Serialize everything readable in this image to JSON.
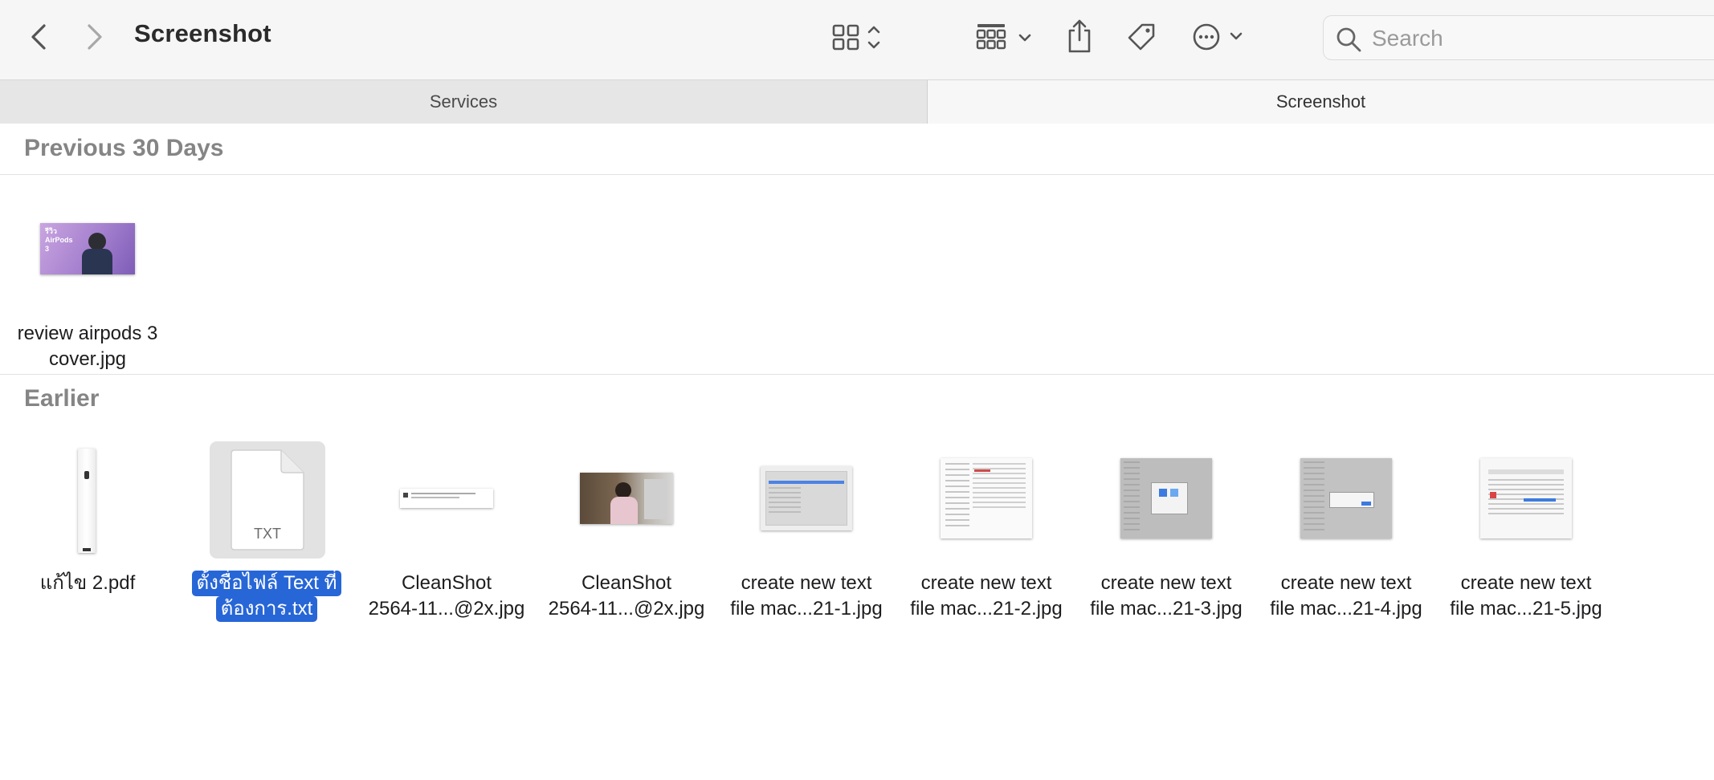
{
  "window": {
    "title": "Screenshot"
  },
  "search": {
    "placeholder": "Search"
  },
  "tabs": [
    {
      "label": "Services"
    },
    {
      "label": "Screenshot"
    }
  ],
  "sections": {
    "recent": {
      "title": "Previous 30 Days"
    },
    "earlier": {
      "title": "Earlier"
    }
  },
  "recent_files": [
    {
      "line1": "review airpods 3",
      "line2": "cover.jpg",
      "thumb_text": "รีวิว AirPods 3"
    }
  ],
  "earlier_files": [
    {
      "line1": "แก้ไข 2.pdf",
      "line2": ""
    },
    {
      "line1": "ตั้งชื่อไฟล์ Text ที่",
      "line2": "ต้องการ.txt",
      "selected": true,
      "badge": "TXT"
    },
    {
      "line1": "CleanShot",
      "line2": "2564-11...@2x.jpg"
    },
    {
      "line1": "CleanShot",
      "line2": "2564-11...@2x.jpg"
    },
    {
      "line1": "create new text",
      "line2": "file mac...21-1.jpg"
    },
    {
      "line1": "create new text",
      "line2": "file mac...21-2.jpg"
    },
    {
      "line1": "create new text",
      "line2": "file mac...21-3.jpg"
    },
    {
      "line1": "create new text",
      "line2": "file mac...21-4.jpg"
    },
    {
      "line1": "create new text",
      "line2": "file mac...21-5.jpg"
    }
  ],
  "colors": {
    "selection": "#2766d6",
    "toolbar_bg": "#f6f6f6",
    "header_gray": "#858585"
  }
}
